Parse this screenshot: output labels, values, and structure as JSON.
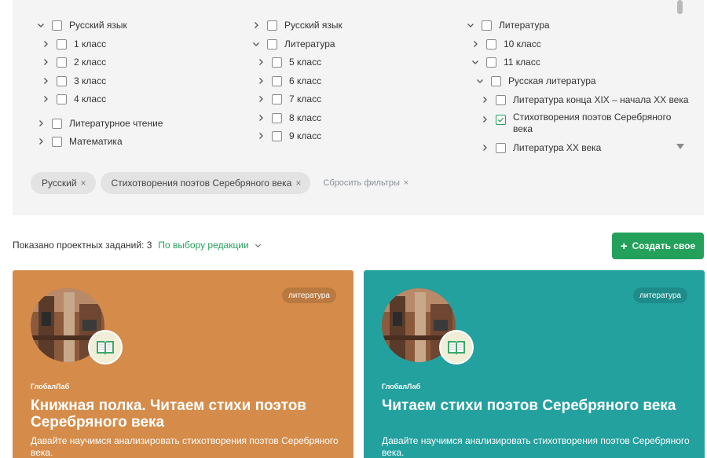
{
  "filters": {
    "col1": [
      {
        "label": "Русский язык",
        "expanded": true
      },
      {
        "label": "1 класс"
      },
      {
        "label": "2 класс"
      },
      {
        "label": "3 класс"
      },
      {
        "label": "4 класс"
      },
      {
        "label": "Литературное чтение"
      },
      {
        "label": "Математика"
      }
    ],
    "col2": [
      {
        "label": "Русский язык"
      },
      {
        "label": "Литература",
        "expanded": true
      },
      {
        "label": "5 класс"
      },
      {
        "label": "6 класс"
      },
      {
        "label": "7 класс"
      },
      {
        "label": "8 класс"
      },
      {
        "label": "9 класс"
      }
    ],
    "col3": [
      {
        "label": "Литература",
        "expanded": true
      },
      {
        "label": "10 класс"
      },
      {
        "label": "11 класс",
        "expanded": true
      },
      {
        "label": "Русская литература",
        "expanded": true
      },
      {
        "label": "Литература конца XIX – начала XX века"
      },
      {
        "label": "Стихотворения поэтов Серебряного века",
        "checked": true
      },
      {
        "label": "Литература XX века"
      }
    ],
    "chips": [
      {
        "label": "Русский",
        "close": "×"
      },
      {
        "label": "Стихотворения поэтов Серебряного века",
        "close": "×"
      }
    ],
    "reset_label": "Сбросить фильтры",
    "reset_icon": "×"
  },
  "results": {
    "count_label": "Показано проектных заданий: 3",
    "sort_label": "По выбору редакции",
    "create_button": "Создать свое",
    "create_plus": "+"
  },
  "cards": [
    {
      "subject": "литература",
      "org": "ГлобалЛаб",
      "title": "Книжная полка. Читаем стихи поэтов Серебряного века",
      "description": "Давайте научимся анализировать стихотворения поэтов Серебряного века.",
      "color": "#d58c4a"
    },
    {
      "subject": "литература",
      "org": "ГлобалЛаб",
      "title": "Читаем стихи поэтов Серебряного века",
      "description": "Давайте научимся анализировать стихотворения поэтов Серебряного века.",
      "color": "#23a19f"
    }
  ],
  "colors": {
    "accent_green": "#23a15a",
    "panel_bg": "#f4f4f4"
  }
}
